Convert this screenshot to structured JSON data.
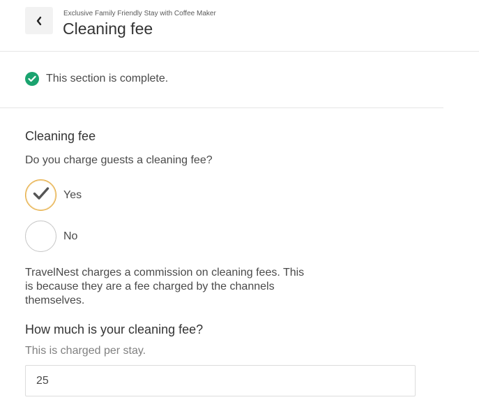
{
  "header": {
    "subtitle": "Exclusive Family Friendly Stay with Coffee Maker",
    "title": "Cleaning fee",
    "back_icon": "chevron-left-icon"
  },
  "status": {
    "icon": "check-circle-icon",
    "icon_color": "#1aa36f",
    "text": "This section is complete."
  },
  "cleaning_fee": {
    "section_title": "Cleaning fee",
    "question": "Do you charge guests a cleaning fee?",
    "options": [
      {
        "label": "Yes",
        "selected": true
      },
      {
        "label": "No",
        "selected": false
      }
    ],
    "selected_color": "#e5a93a",
    "info": "TravelNest charges a commission on cleaning fees. This is because they are a fee charged by the channels themselves."
  },
  "fee_amount": {
    "title": "How much is your cleaning fee?",
    "hint": "This is charged per stay.",
    "value": "25"
  }
}
